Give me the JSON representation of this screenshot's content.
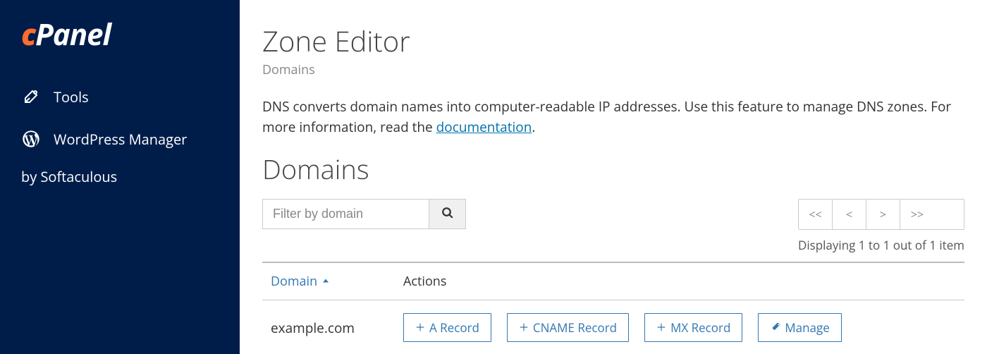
{
  "sidebar": {
    "logo_brand": "Panel",
    "items": [
      {
        "label": "Tools"
      },
      {
        "label": "WordPress Manager"
      }
    ],
    "by_line": "by Softaculous"
  },
  "header": {
    "title": "Zone Editor",
    "breadcrumb": "Domains"
  },
  "description": {
    "text_before": "DNS converts domain names into computer-readable IP addresses. Use this feature to manage DNS zones. For more information, read the ",
    "link_text": "documentation",
    "text_after": "."
  },
  "domains": {
    "heading": "Domains",
    "search_placeholder": "Filter by domain",
    "pagination": {
      "first": "<<",
      "prev": "<",
      "next": ">",
      "last": ">>"
    },
    "display_info": "Displaying 1 to 1 out of 1 item",
    "columns": {
      "domain": "Domain",
      "actions": "Actions"
    },
    "rows": [
      {
        "domain": "example.com",
        "actions": {
          "a_record": "A Record",
          "cname_record": "CNAME Record",
          "mx_record": "MX Record",
          "manage": "Manage"
        }
      }
    ]
  }
}
